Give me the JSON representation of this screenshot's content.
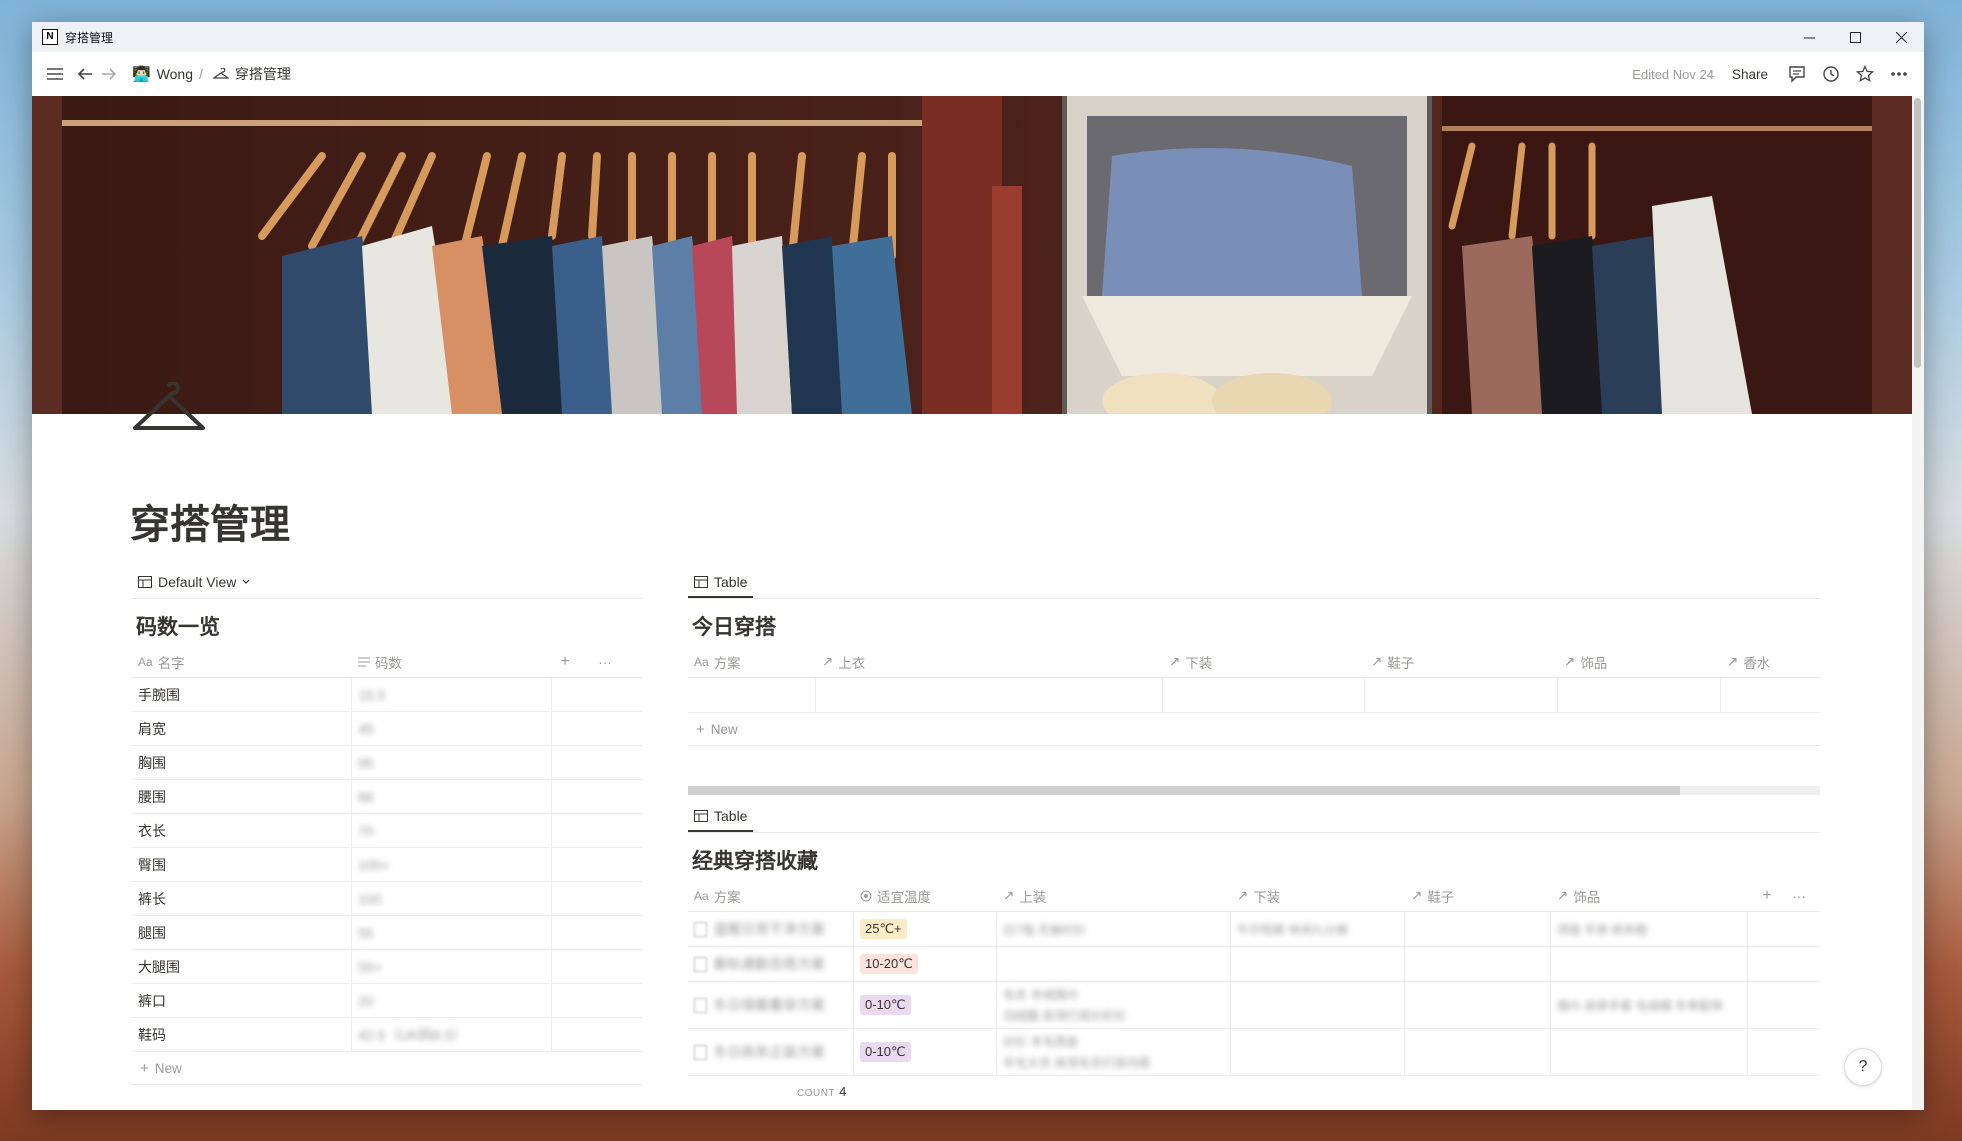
{
  "window": {
    "title": "穿搭管理"
  },
  "nav": {
    "crumbs": [
      {
        "label": "Wong"
      },
      {
        "label": "穿搭管理"
      }
    ],
    "edited": "Edited Nov 24",
    "share": "Share"
  },
  "page": {
    "title": "穿搭管理"
  },
  "sizes_db": {
    "view_label": "Default View",
    "title": "码数一览",
    "col_name": "名字",
    "col_size": "码数",
    "rows": [
      {
        "name": "手腕围",
        "value": "15.5"
      },
      {
        "name": "肩宽",
        "value": "45"
      },
      {
        "name": "胸围",
        "value": "95"
      },
      {
        "name": "腰围",
        "value": "88"
      },
      {
        "name": "衣长",
        "value": "70"
      },
      {
        "name": "臀围",
        "value": "100+"
      },
      {
        "name": "裤长",
        "value": "100"
      },
      {
        "name": "腿围",
        "value": "55"
      },
      {
        "name": "大腿围",
        "value": "55+"
      },
      {
        "name": "裤口",
        "value": "20"
      },
      {
        "name": "鞋码",
        "value": "42.5（UK码8.5）"
      }
    ],
    "new_label": "New"
  },
  "today_db": {
    "tab_label": "Table",
    "title": "今日穿搭",
    "columns": [
      "方案",
      "上衣",
      "下装",
      "鞋子",
      "饰品",
      "香水"
    ],
    "new_label": "New"
  },
  "classic_db": {
    "tab_label": "Table",
    "title": "经典穿搭收藏",
    "columns": [
      "方案",
      "适宜温度",
      "上装",
      "下装",
      "鞋子",
      "饰品"
    ],
    "rows": [
      {
        "plan": "温暖日常干净方案",
        "temp": "25℃+",
        "temp_color": "#fbecc8",
        "tops": [
          "白T恤 无袖衬衫"
        ],
        "bottoms": "牛仔短裤 休闲九分裤",
        "shoes": "",
        "acc": [
          "项链 手表 帆布鞋"
        ]
      },
      {
        "plan": "春秋通勤百搭方案",
        "temp": "10-20℃",
        "temp_color": "#fde2dd",
        "tops": [],
        "bottoms": "",
        "shoes": "",
        "acc": []
      },
      {
        "plan": "冬日保暖叠穿方案",
        "temp": "0-10℃",
        "temp_color": "#ead9f0",
        "tops": [
          "毛衣 羊绒围巾",
          "羽绒服 高领打底针织衫"
        ],
        "bottoms": "",
        "shoes": "",
        "acc": [
          "围巾 皮质手套 毛线帽 冬季配饰"
        ]
      },
      {
        "plan": "冬日商务正装方案",
        "temp": "0-10℃",
        "temp_color": "#ead9f0",
        "tops": [
          "衬衫 羊毛西装",
          "羊毛大衣 高领毛衣打底内搭"
        ],
        "bottoms": "",
        "shoes": "",
        "acc": []
      }
    ],
    "count_label": "COUNT",
    "count_value": "4"
  },
  "help_label": "?"
}
